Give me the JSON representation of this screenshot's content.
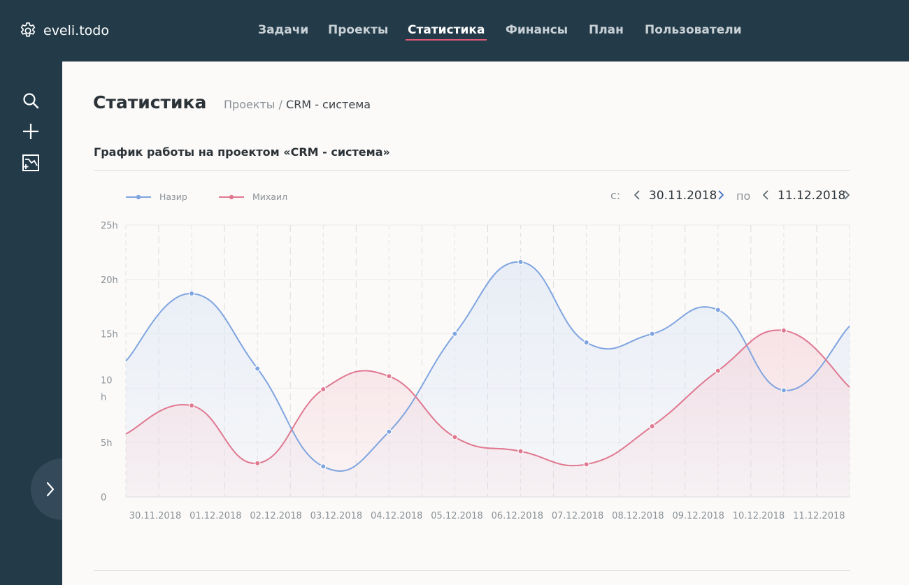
{
  "app": {
    "name": "eveli.todo",
    "logo_icon": "gear-icon"
  },
  "nav": {
    "items": [
      "Задачи",
      "Проекты",
      "Статистика",
      "Финансы",
      "План",
      "Пользователи"
    ],
    "active": 2,
    "accent": "#e05a77"
  },
  "sidebar": {
    "icons": [
      "search-icon",
      "plus-icon",
      "chart-add-icon"
    ],
    "expand_icon": "chevron-right-icon"
  },
  "page": {
    "title": "Статистика",
    "breadcrumb": {
      "parent": "Проекты",
      "separator": "/",
      "current": "CRM - система"
    },
    "section_title": "График работы на проектом «CRM - система»"
  },
  "range": {
    "from_label": "с:",
    "from": "30.11.2018",
    "to_label": "по",
    "to": "11.12.2018"
  },
  "chart_data": {
    "type": "line",
    "categories": [
      "30.11.2018",
      "01.12.2018",
      "02.12.2018",
      "03.12.2018",
      "04.12.2018",
      "05.12.2018",
      "06.12.2018",
      "07.12.2018",
      "08.12.2018",
      "09.12.2018",
      "10.12.2018",
      "11.12.2018"
    ],
    "series": [
      {
        "name": "Назир",
        "color": "#7fa5e0",
        "values": [
          12.5,
          18.7,
          11.8,
          2.8,
          6.0,
          15.0,
          21.6,
          14.2,
          15.0,
          17.2,
          9.8,
          15.7
        ]
      },
      {
        "name": "Михаил",
        "color": "#e07890",
        "values": [
          5.8,
          8.4,
          3.1,
          9.9,
          11.1,
          5.5,
          4.2,
          3.0,
          6.5,
          11.6,
          15.3,
          10.1
        ]
      }
    ],
    "ylim": [
      0,
      25
    ],
    "yticks": [
      "0",
      "5h",
      "10\nh",
      "15h",
      "20h",
      "25h"
    ],
    "legend_position": "top-left",
    "grid": true
  }
}
